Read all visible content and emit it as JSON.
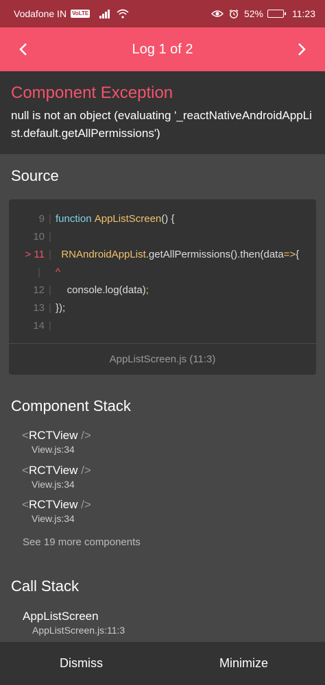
{
  "status_bar": {
    "carrier": "Vodafone IN",
    "network_badge": "VoLTE",
    "battery_percent": "52%",
    "battery_level": 0.52,
    "time": "11:23",
    "icons": [
      "signal-icon",
      "wifi-icon",
      "eye-icon",
      "alarm-icon",
      "battery-icon"
    ]
  },
  "header": {
    "title": "Log 1 of 2",
    "prev_icon": "chevron-left-icon",
    "next_icon": "chevron-right-icon"
  },
  "exception": {
    "title": "Component Exception",
    "message": "null is not an object (evaluating '_reactNativeAndroidAppList.default.getAllPermissions')"
  },
  "source": {
    "title": "Source",
    "lines": [
      {
        "gutter": "9",
        "keyword": "function ",
        "fn": "AppListScreen",
        "text": "() {"
      },
      {
        "gutter": "10"
      },
      {
        "gutter": "> 11",
        "fn": "RNAndroidAppList",
        "text": ".getAllPermissions().then(data",
        "arrow": "=>",
        "tail": "{"
      },
      {
        "gutter": "",
        "caret": "^"
      },
      {
        "gutter": "12",
        "text": "    console.log(data)",
        "semi": ";"
      },
      {
        "gutter": "13",
        "text": "});"
      },
      {
        "gutter": "14"
      }
    ],
    "file_location": "AppListScreen.js (11:3)"
  },
  "component_stack": {
    "title": "Component Stack",
    "items": [
      {
        "open": "<",
        "name": "RCTView",
        "close": " />",
        "file": "View.js:34"
      },
      {
        "open": "<",
        "name": "RCTView",
        "close": " />",
        "file": "View.js:34"
      },
      {
        "open": "<",
        "name": "RCTView",
        "close": " />",
        "file": "View.js:34"
      }
    ],
    "see_more": "See 19 more components"
  },
  "call_stack": {
    "title": "Call Stack",
    "items": [
      {
        "name": "AppListScreen",
        "file": "AppListScreen.js:11:3"
      }
    ]
  },
  "footer": {
    "dismiss": "Dismiss",
    "minimize": "Minimize"
  },
  "colors": {
    "accent": "#f4536b",
    "status_bar": "#a0303c",
    "panel": "#333333",
    "background": "#474747"
  }
}
